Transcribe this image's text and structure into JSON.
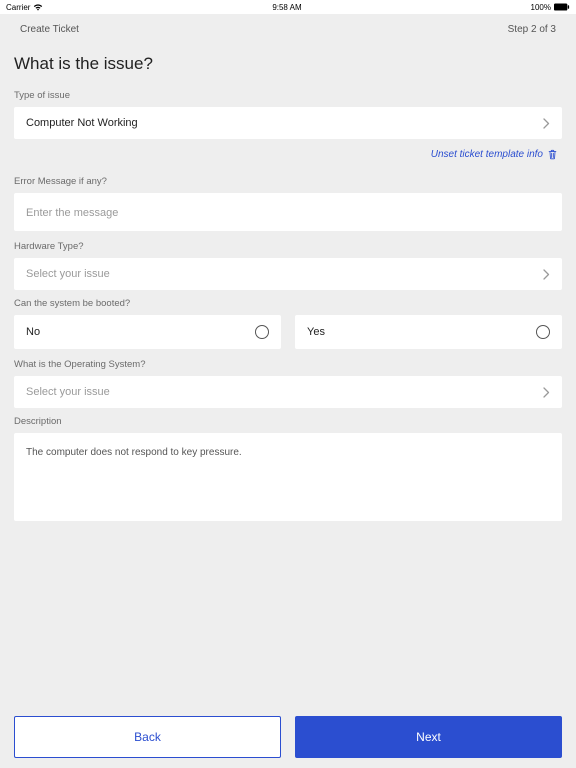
{
  "status_bar": {
    "carrier": "Carrier",
    "time": "9:58 AM",
    "battery": "100%"
  },
  "header": {
    "title": "Create Ticket",
    "step": "Step 2 of 3"
  },
  "page_title": "What is the issue?",
  "type_of_issue": {
    "label": "Type of issue",
    "value": "Computer Not Working"
  },
  "unset_link": "Unset ticket template info",
  "error_message": {
    "label": "Error Message if any?",
    "placeholder": "Enter the message",
    "value": ""
  },
  "hardware_type": {
    "label": "Hardware Type?",
    "placeholder": "Select your issue"
  },
  "booted": {
    "label": "Can the system be booted?",
    "option_no": "No",
    "option_yes": "Yes"
  },
  "os": {
    "label": "What is the Operating System?",
    "placeholder": "Select your issue"
  },
  "description": {
    "label": "Description",
    "value": "The computer does not respond to key pressure."
  },
  "footer": {
    "back": "Back",
    "next": "Next"
  }
}
